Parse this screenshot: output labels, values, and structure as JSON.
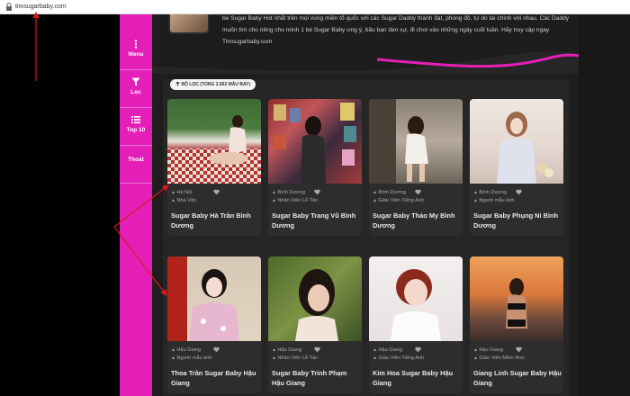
{
  "browser": {
    "url": "timsugarbaby.com"
  },
  "sidebar": {
    "items": [
      {
        "label": "Menu",
        "icon": "menu-dots-icon"
      },
      {
        "label": "Lọc",
        "icon": "filter-icon"
      },
      {
        "label": "Top 10",
        "icon": "list-icon"
      },
      {
        "label": "Thoát",
        "icon": ""
      }
    ]
  },
  "intro": {
    "text": "bé Sugar Baby Hot nhất trên mọi vùng miền tổ quốc với các Sugar Daddy thành đạt, phong độ, tự do tài chính với nhau. Các Daddy muốn tìm cho riêng cho mình 1 bé Sugar Baby ưng ý, bầu bạn tâm sự, đi chơi vào những ngày cuối tuần. Hãy truy cập ngay Timsugarbaby.com"
  },
  "filter": {
    "label": "BỘ LỌC (TỔNG 3.562 MẪU BAY)"
  },
  "cards": [
    {
      "location": "Hà Nội",
      "job": "Nhà Văn",
      "name": "Sugar Baby Hà Trần Bình Dương"
    },
    {
      "location": "Bình Dương",
      "job": "Nhân Viên Lễ Tân",
      "name": "Sugar Baby Trang Vũ Bình Dương"
    },
    {
      "location": "Bình Dương",
      "job": "Giáo Viên Tiếng Anh",
      "name": "Sugar Baby Thảo My Bình Dương"
    },
    {
      "location": "Bình Dương",
      "job": "Người mẫu ảnh",
      "name": "Sugar Baby Phụng Ni Bình Dương"
    },
    {
      "location": "Hậu Giang",
      "job": "Người mẫu ảnh",
      "name": "Thoa Trần Sugar Baby Hậu Giang"
    },
    {
      "location": "Hậu Giang",
      "job": "Nhân Viên Lễ Tân",
      "name": "Sugar Baby Trinh Phạm Hậu Giang"
    },
    {
      "location": "Hậu Giang",
      "job": "Giáo Viên Tiếng Anh",
      "name": "Kim Hoa Sugar Baby Hậu Giang"
    },
    {
      "location": "Hậu Giang",
      "job": "Giáo Viên Mầm Non",
      "name": "Giang Linh Sugar Baby Hậu Giang"
    }
  ],
  "colors": {
    "accent": "#e41fb8",
    "annotation": "#e0161b"
  }
}
